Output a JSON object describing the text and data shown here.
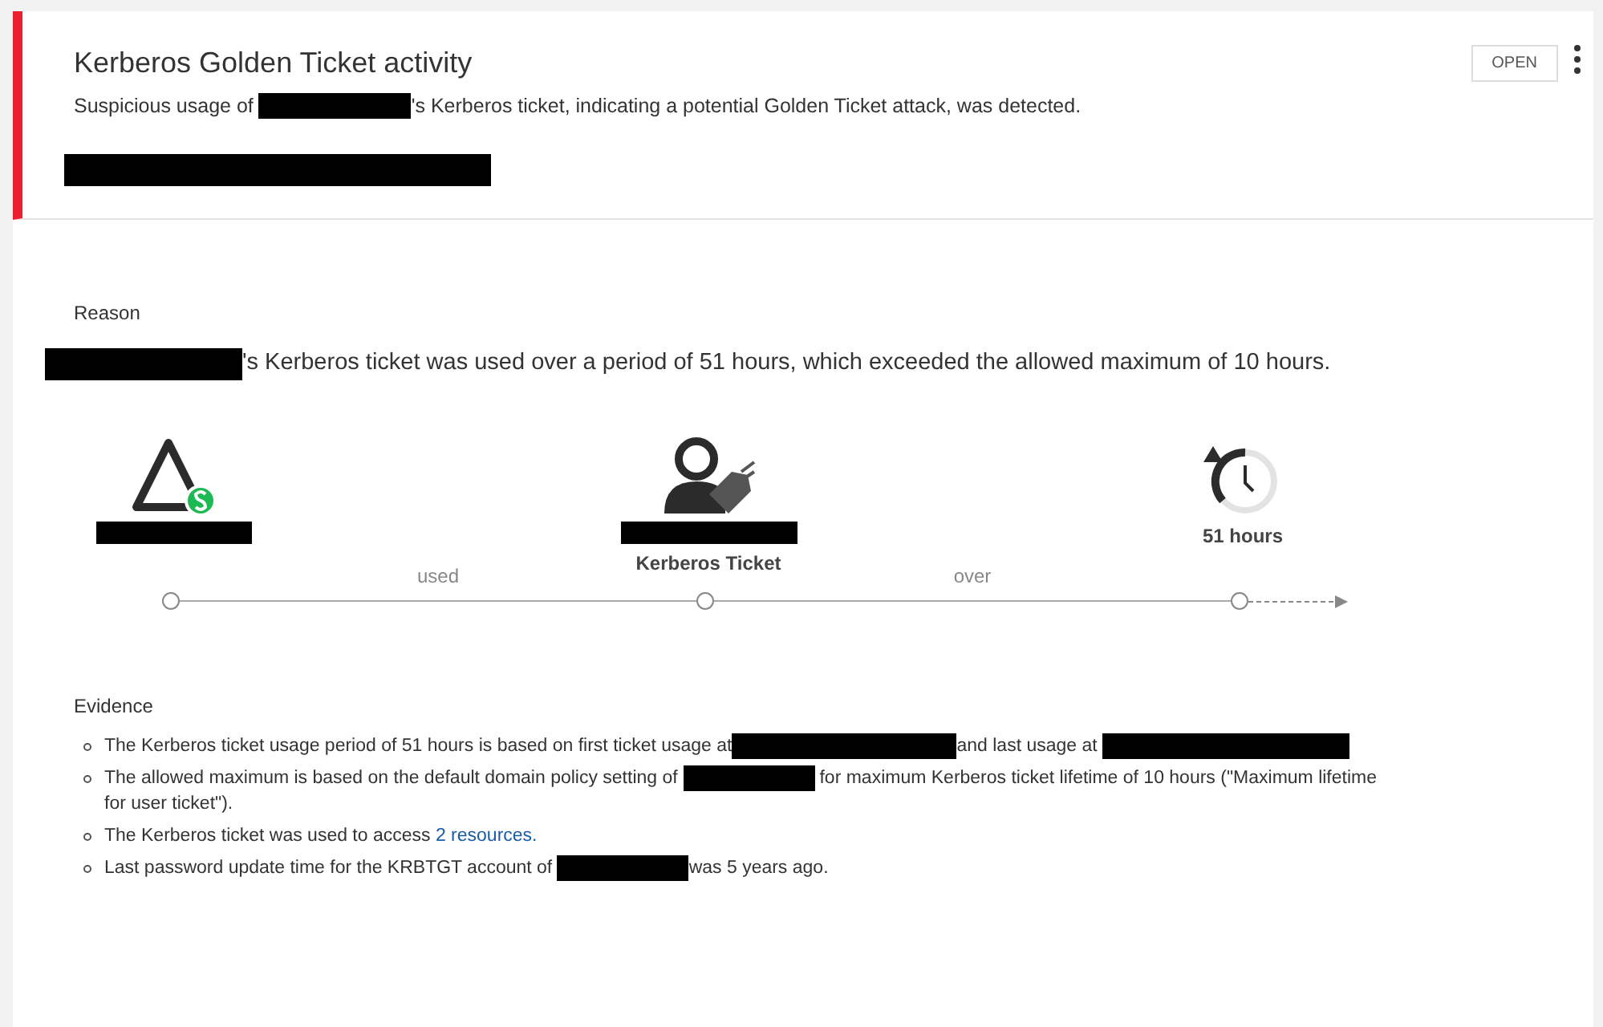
{
  "alert": {
    "title": "Kerberos Golden Ticket activity",
    "status": "OPEN",
    "description": [
      {
        "kind": "text",
        "text": "Suspicious usage of "
      },
      {
        "kind": "redacted"
      },
      {
        "kind": "text",
        "text": "'s Kerberos ticket, indicating a potential Golden Ticket attack, was detected."
      }
    ],
    "subline_redacted": true
  },
  "reason": {
    "heading": "Reason",
    "sentence": [
      {
        "kind": "redacted"
      },
      {
        "kind": "text",
        "text": "'s Kerberos ticket was used over a period of 51 hours, which exceeded the allowed maximum of 10 hours."
      }
    ]
  },
  "diagram": {
    "nodes": [
      {
        "kind": "computer",
        "redacted": true
      },
      {
        "kind": "ticket",
        "redacted": true,
        "caption": "Kerberos Ticket"
      },
      {
        "kind": "duration",
        "redacted": false,
        "caption": "51 hours"
      }
    ],
    "edges": [
      "used",
      "over"
    ]
  },
  "evidence": {
    "heading": "Evidence",
    "items": [
      [
        {
          "kind": "text",
          "text": "The Kerberos ticket usage period of 51 hours is based on first ticket usage at"
        },
        {
          "kind": "redacted"
        },
        {
          "kind": "text",
          "text": "and last usage at "
        },
        {
          "kind": "redacted"
        }
      ],
      [
        {
          "kind": "text",
          "text": "The allowed maximum is based on the default domain policy setting of "
        },
        {
          "kind": "redacted"
        },
        {
          "kind": "text",
          "text": " for maximum Kerberos ticket lifetime of 10 hours (\"Maximum lifetime"
        },
        {
          "kind": "text",
          "text": "for user ticket\")."
        }
      ],
      [
        {
          "kind": "text",
          "text": "The Kerberos ticket was used to access "
        },
        {
          "kind": "link",
          "text": "2 resources."
        }
      ],
      [
        {
          "kind": "text",
          "text": "Last password update time for the KRBTGT account of "
        },
        {
          "kind": "redacted"
        },
        {
          "kind": "text",
          "text": "was 5 years ago."
        }
      ]
    ]
  }
}
